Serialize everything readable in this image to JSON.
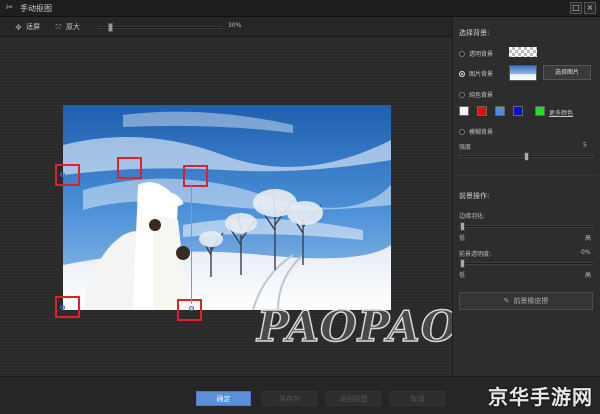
{
  "window": {
    "title": "手动抠图",
    "minimize_label": "□",
    "close_label": "×"
  },
  "toolbar": {
    "fit_label": "适屏",
    "actual_label": "原大",
    "zoom_value": "30%",
    "zoom_fraction": 0.08
  },
  "panel": {
    "bg_section_title": "选择背景:",
    "transparent_label": "透明背景",
    "image_label": "图片背景",
    "pick_image_label": "选择图片",
    "solid_label": "纯色背景",
    "swatches": [
      "#ffffff",
      "#ff0000",
      "#4a8fd8",
      "#1010cc",
      "#20dd20"
    ],
    "more_color_label": "更多颜色",
    "blur_label": "模糊背景",
    "strength_label": "强度",
    "strength_value": "5",
    "strength_fraction": 0.5,
    "fg_section_title": "前景操作:",
    "feather_label": "边缘羽化:",
    "feather_low": "低",
    "feather_high": "高",
    "feather_fraction": 0.0,
    "opacity_label": "前景透明度:",
    "opacity_value": "0%",
    "opacity_low": "低",
    "opacity_high": "高",
    "opacity_fraction": 0.0,
    "eraser_label": "前景橡皮擦"
  },
  "bottom": {
    "ok_label": "确定",
    "save_as_label": "另存为",
    "return_label": "返回抠图",
    "cancel_label": "取消"
  },
  "watermark": "PAOPAOCHE",
  "brand": "京华手游网",
  "colors": {
    "accent": "#5b8fd8",
    "handle": "#e0202a",
    "guide": "#6a9aff"
  }
}
